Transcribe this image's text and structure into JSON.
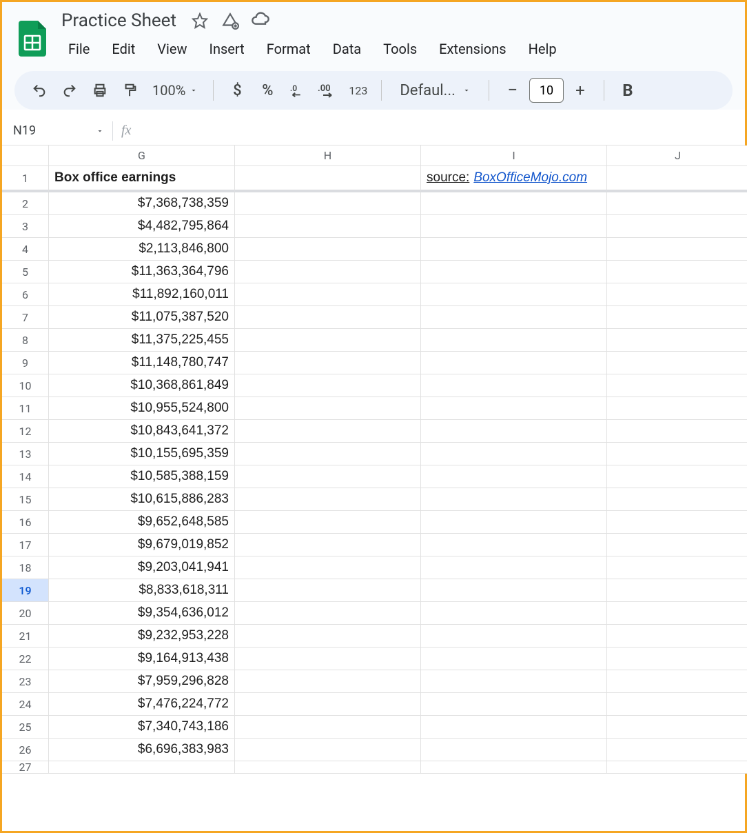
{
  "doc": {
    "title": "Practice Sheet"
  },
  "menu": [
    "File",
    "Edit",
    "View",
    "Insert",
    "Format",
    "Data",
    "Tools",
    "Extensions",
    "Help"
  ],
  "toolbar": {
    "zoom": "100%",
    "font": "Defaul...",
    "fontSize": "10",
    "fmt123": "123"
  },
  "namebox": {
    "ref": "N19",
    "fx": "fx"
  },
  "columns": [
    "G",
    "H",
    "I",
    "J"
  ],
  "selectedRow": 19,
  "sheetHeader": {
    "col1": "Box office earnings",
    "sourceLabel": "source: ",
    "sourceLink": "BoxOfficeMojo.com"
  },
  "rows": [
    "$7,368,738,359",
    "$4,482,795,864",
    "$2,113,846,800",
    "$11,363,364,796",
    "$11,892,160,011",
    "$11,075,387,520",
    "$11,375,225,455",
    "$11,148,780,747",
    "$10,368,861,849",
    "$10,955,524,800",
    "$10,843,641,372",
    "$10,155,695,359",
    "$10,585,388,159",
    "$10,615,886,283",
    "$9,652,648,585",
    "$9,679,019,852",
    "$9,203,041,941",
    "$8,833,618,311",
    "$9,354,636,012",
    "$9,232,953,228",
    "$9,164,913,438",
    "$7,959,296,828",
    "$7,476,224,772",
    "$7,340,743,186",
    "$6,696,383,983"
  ]
}
